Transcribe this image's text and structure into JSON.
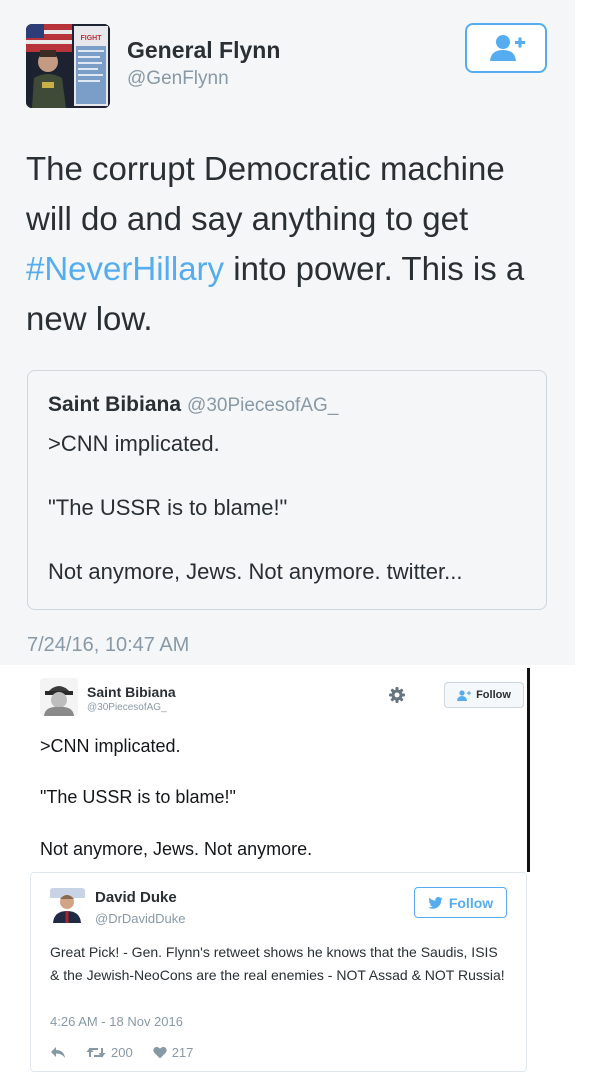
{
  "tweet1": {
    "display_name": "General Flynn",
    "handle": "@GenFlynn",
    "avatar_book_word": "FIGHT",
    "text_before": "The corrupt Democratic machine will do and say anything to get ",
    "hashtag": "#NeverHillary",
    "text_after": " into power. This is a new low.",
    "quoted": {
      "display_name": "Saint Bibiana",
      "handle": "@30PiecesofAG_",
      "lines": [
        ">CNN implicated.",
        "\"The USSR is to blame!\"",
        "Not anymore, Jews. Not anymore. twitter..."
      ]
    },
    "timestamp": "7/24/16, 10:47 AM",
    "follow_icon": "add-user-icon"
  },
  "tweet2": {
    "display_name": "Saint Bibiana",
    "handle": "@30PiecesofAG_",
    "follow_label": "Follow",
    "lines": [
      ">CNN implicated.",
      "\"The USSR is to blame!\"",
      "Not anymore, Jews. Not anymore."
    ]
  },
  "tweet3": {
    "display_name": "David Duke",
    "handle": "@DrDavidDuke",
    "follow_label": "Follow",
    "text": "Great Pick! - Gen. Flynn's retweet shows he knows that the Saudis, ISIS & the Jewish-NeoCons are the real enemies - NOT Assad & NOT Russia!",
    "timestamp": "4:26 AM - 18 Nov 2016",
    "retweets": "200",
    "likes": "217"
  },
  "colors": {
    "twitter_blue": "#55acee",
    "muted_gray": "#8899a6",
    "text_dark": "#292f33",
    "card_bg": "#f5f6f7"
  }
}
